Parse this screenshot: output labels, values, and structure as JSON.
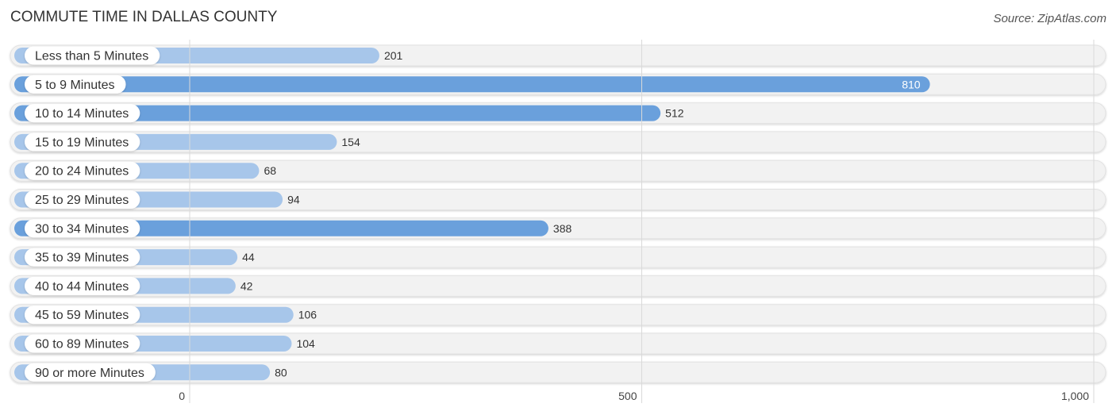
{
  "header": {
    "title": "COMMUTE TIME IN DALLAS COUNTY",
    "source": "Source: ZipAtlas.com"
  },
  "chart_data": {
    "type": "bar",
    "orientation": "horizontal",
    "title": "COMMUTE TIME IN DALLAS COUNTY",
    "source": "Source: ZipAtlas.com",
    "xlabel": "",
    "ylabel": "",
    "categories": [
      "Less than 5 Minutes",
      "5 to 9 Minutes",
      "10 to 14 Minutes",
      "15 to 19 Minutes",
      "20 to 24 Minutes",
      "25 to 29 Minutes",
      "30 to 34 Minutes",
      "35 to 39 Minutes",
      "40 to 44 Minutes",
      "45 to 59 Minutes",
      "60 to 89 Minutes",
      "90 or more Minutes"
    ],
    "values": [
      201,
      810,
      512,
      154,
      68,
      94,
      388,
      44,
      42,
      106,
      104,
      80
    ],
    "value_labels": [
      "201",
      "810",
      "512",
      "154",
      "68",
      "94",
      "388",
      "44",
      "42",
      "106",
      "104",
      "80"
    ],
    "xlim": [
      0,
      1000
    ],
    "xticks": [
      0,
      500,
      1000
    ],
    "xtick_labels": [
      "0",
      "500",
      "1,000"
    ],
    "grid": true,
    "colors": {
      "bar_light": "#a7c6ea",
      "bar_dark": "#6aa0dc",
      "track": "#f2f2f2",
      "label_pill": "#ffffff",
      "value_inside_text": "#ffffff"
    }
  }
}
